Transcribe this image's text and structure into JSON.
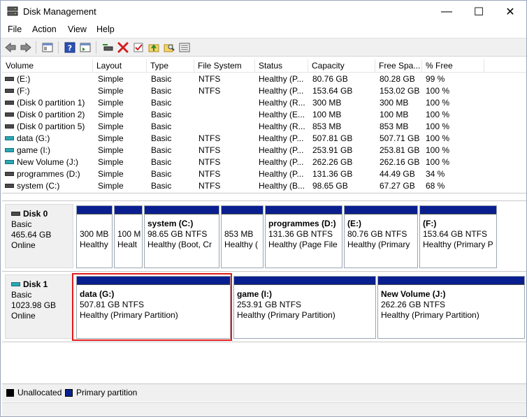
{
  "window": {
    "title": "Disk Management",
    "minimize_glyph": "—",
    "maximize_glyph": "☐",
    "close_glyph": "✕"
  },
  "menu": [
    "File",
    "Action",
    "View",
    "Help"
  ],
  "toolbar": {
    "icons": [
      "back-arrow-icon",
      "forward-arrow-icon",
      "console-tree-icon",
      "help-icon",
      "properties-icon",
      "connect-disk-icon",
      "delete-icon",
      "check-icon",
      "folder-up-icon",
      "search-folder-icon",
      "list-view-icon"
    ]
  },
  "columns": [
    "Volume",
    "Layout",
    "Type",
    "File System",
    "Status",
    "Capacity",
    "Free Spa...",
    "% Free"
  ],
  "volumes": [
    {
      "name": "(E:)",
      "layout": "Simple",
      "type": "Basic",
      "fs": "NTFS",
      "status": "Healthy (P...",
      "capacity": "80.76 GB",
      "free": "80.28 GB",
      "pct": "99 %",
      "icon": "dark"
    },
    {
      "name": "(F:)",
      "layout": "Simple",
      "type": "Basic",
      "fs": "NTFS",
      "status": "Healthy (P...",
      "capacity": "153.64 GB",
      "free": "153.02 GB",
      "pct": "100 %",
      "icon": "dark"
    },
    {
      "name": "(Disk 0 partition 1)",
      "layout": "Simple",
      "type": "Basic",
      "fs": "",
      "status": "Healthy (R...",
      "capacity": "300 MB",
      "free": "300 MB",
      "pct": "100 %",
      "icon": "dark"
    },
    {
      "name": "(Disk 0 partition 2)",
      "layout": "Simple",
      "type": "Basic",
      "fs": "",
      "status": "Healthy (E...",
      "capacity": "100 MB",
      "free": "100 MB",
      "pct": "100 %",
      "icon": "dark"
    },
    {
      "name": "(Disk 0 partition 5)",
      "layout": "Simple",
      "type": "Basic",
      "fs": "",
      "status": "Healthy (R...",
      "capacity": "853 MB",
      "free": "853 MB",
      "pct": "100 %",
      "icon": "dark"
    },
    {
      "name": "data (G:)",
      "layout": "Simple",
      "type": "Basic",
      "fs": "NTFS",
      "status": "Healthy (P...",
      "capacity": "507.81 GB",
      "free": "507.71 GB",
      "pct": "100 %",
      "icon": "teal"
    },
    {
      "name": "game (I:)",
      "layout": "Simple",
      "type": "Basic",
      "fs": "NTFS",
      "status": "Healthy (P...",
      "capacity": "253.91 GB",
      "free": "253.81 GB",
      "pct": "100 %",
      "icon": "teal"
    },
    {
      "name": "New Volume (J:)",
      "layout": "Simple",
      "type": "Basic",
      "fs": "NTFS",
      "status": "Healthy (P...",
      "capacity": "262.26 GB",
      "free": "262.16 GB",
      "pct": "100 %",
      "icon": "teal"
    },
    {
      "name": "programmes (D:)",
      "layout": "Simple",
      "type": "Basic",
      "fs": "NTFS",
      "status": "Healthy (P...",
      "capacity": "131.36 GB",
      "free": "44.49 GB",
      "pct": "34 %",
      "icon": "dark"
    },
    {
      "name": "system (C:)",
      "layout": "Simple",
      "type": "Basic",
      "fs": "NTFS",
      "status": "Healthy (B...",
      "capacity": "98.65 GB",
      "free": "67.27 GB",
      "pct": "68 %",
      "icon": "dark"
    }
  ],
  "disk0": {
    "name": "Disk 0",
    "type": "Basic",
    "size": "465.64 GB",
    "state": "Online",
    "partitions": [
      {
        "name": "",
        "line1": "300 MB",
        "line2": "Healthy"
      },
      {
        "name": "",
        "line1": "100 M",
        "line2": "Healt"
      },
      {
        "name": "system  (C:)",
        "line1": "98.65 GB NTFS",
        "line2": "Healthy (Boot, Cr"
      },
      {
        "name": "",
        "line1": "853 MB",
        "line2": "Healthy ("
      },
      {
        "name": "programmes  (D:)",
        "line1": "131.36 GB NTFS",
        "line2": "Healthy (Page File"
      },
      {
        "name": "(E:)",
        "line1": "80.76 GB NTFS",
        "line2": "Healthy (Primary"
      },
      {
        "name": "(F:)",
        "line1": "153.64 GB NTFS",
        "line2": "Healthy (Primary P"
      }
    ]
  },
  "disk1": {
    "name": "Disk 1",
    "type": "Basic",
    "size": "1023.98 GB",
    "state": "Online",
    "partitions": [
      {
        "name": "data  (G:)",
        "line1": "507.81 GB NTFS",
        "line2": "Healthy (Primary Partition)"
      },
      {
        "name": "game  (I:)",
        "line1": "253.91 GB NTFS",
        "line2": "Healthy (Primary Partition)"
      },
      {
        "name": "New Volume  (J:)",
        "line1": "262.26 GB NTFS",
        "line2": "Healthy (Primary Partition)"
      }
    ]
  },
  "legend": {
    "unallocated": "Unallocated",
    "primary": "Primary partition",
    "unallocated_color": "#000000",
    "primary_color": "#0a1f8f"
  }
}
